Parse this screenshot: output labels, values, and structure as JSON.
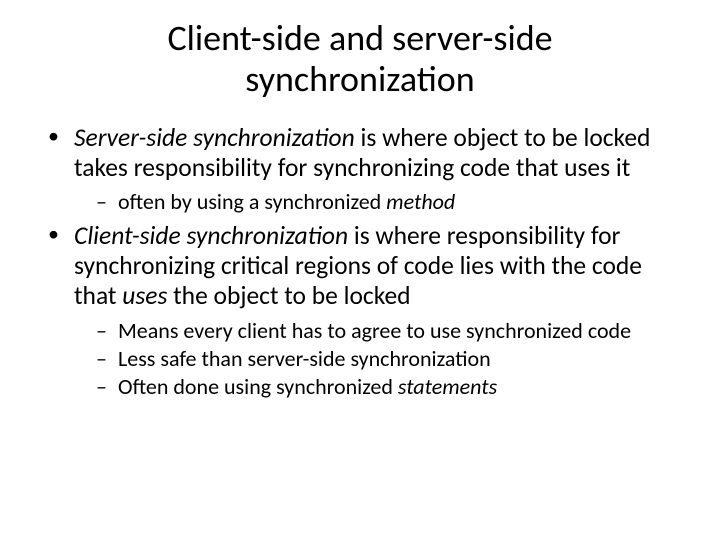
{
  "title": "Client-side and server-side synchronization",
  "bullets": [
    {
      "prefix_em": "Server-side synchronization",
      "rest": " is where object to be locked takes responsibility for synchronizing code that uses it",
      "subs": [
        {
          "text1": "often by using a synchronized ",
          "em": "method",
          "text2": ""
        }
      ]
    },
    {
      "prefix_em": "Client-side synchronization",
      "rest_a": " is where responsibility for synchronizing critical regions of code lies with the code that ",
      "rest_em": "uses",
      "rest_b": " the object to be locked",
      "subs": [
        {
          "text1": "Means every client has to agree to use synchronized code",
          "em": "",
          "text2": ""
        },
        {
          "text1": "Less safe than server-side synchronization",
          "em": "",
          "text2": ""
        },
        {
          "text1": "Often done using synchronized ",
          "em": "statements",
          "text2": ""
        }
      ]
    }
  ]
}
